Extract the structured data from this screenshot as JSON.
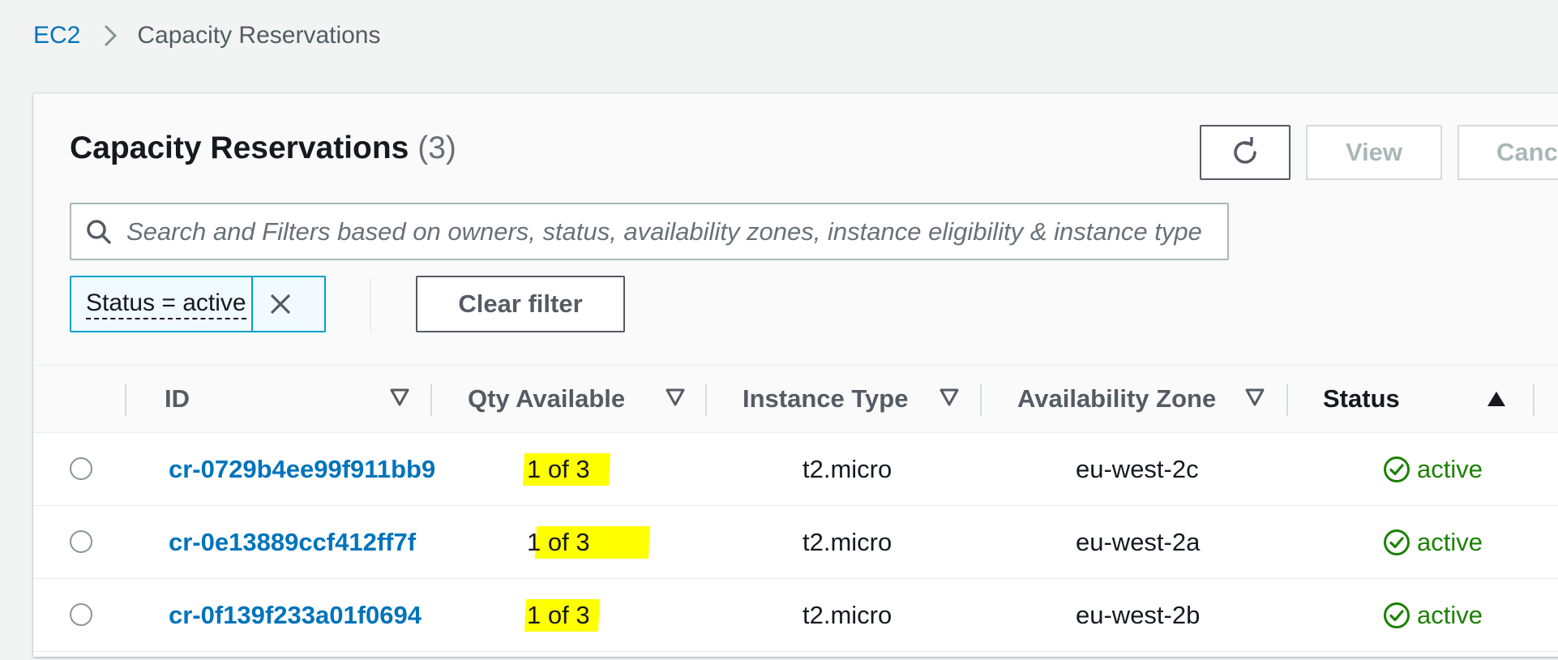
{
  "breadcrumb": {
    "root": "EC2",
    "current": "Capacity Reservations"
  },
  "header": {
    "title": "Capacity Reservations",
    "count": "(3)",
    "view_label": "View",
    "cancel_label": "Cancel"
  },
  "search": {
    "placeholder": "Search and Filters based on owners, status, availability zones, instance eligibility & instance type",
    "value": ""
  },
  "filter": {
    "token_label": "Status = active",
    "clear_label": "Clear filter"
  },
  "table": {
    "columns": [
      "ID",
      "Qty Available",
      "Instance Type",
      "Availability Zone",
      "Status"
    ],
    "sorted_column": "Status",
    "rows": [
      {
        "id": "cr-0729b4ee99f911bb9",
        "qty": "1 of 3",
        "instance_type": "t2.micro",
        "az": "eu-west-2c",
        "status": "active"
      },
      {
        "id": "cr-0e13889ccf412ff7f",
        "qty": "1 of 3",
        "instance_type": "t2.micro",
        "az": "eu-west-2a",
        "status": "active"
      },
      {
        "id": "cr-0f139f233a01f0694",
        "qty": "1 of 3",
        "instance_type": "t2.micro",
        "az": "eu-west-2b",
        "status": "active"
      }
    ]
  },
  "colors": {
    "link": "#0073bb",
    "status_ok": "#1d8102",
    "token_border": "#00a1c9",
    "highlight": "#ffff00"
  },
  "icons": {
    "breadcrumb_separator": "chevron-right-icon",
    "refresh": "refresh-icon",
    "search": "search-icon",
    "remove_token": "close-icon",
    "sort_column": "caret-down-outline-icon",
    "sort_active": "caret-up-filled-icon",
    "status": "check-circle-icon"
  }
}
